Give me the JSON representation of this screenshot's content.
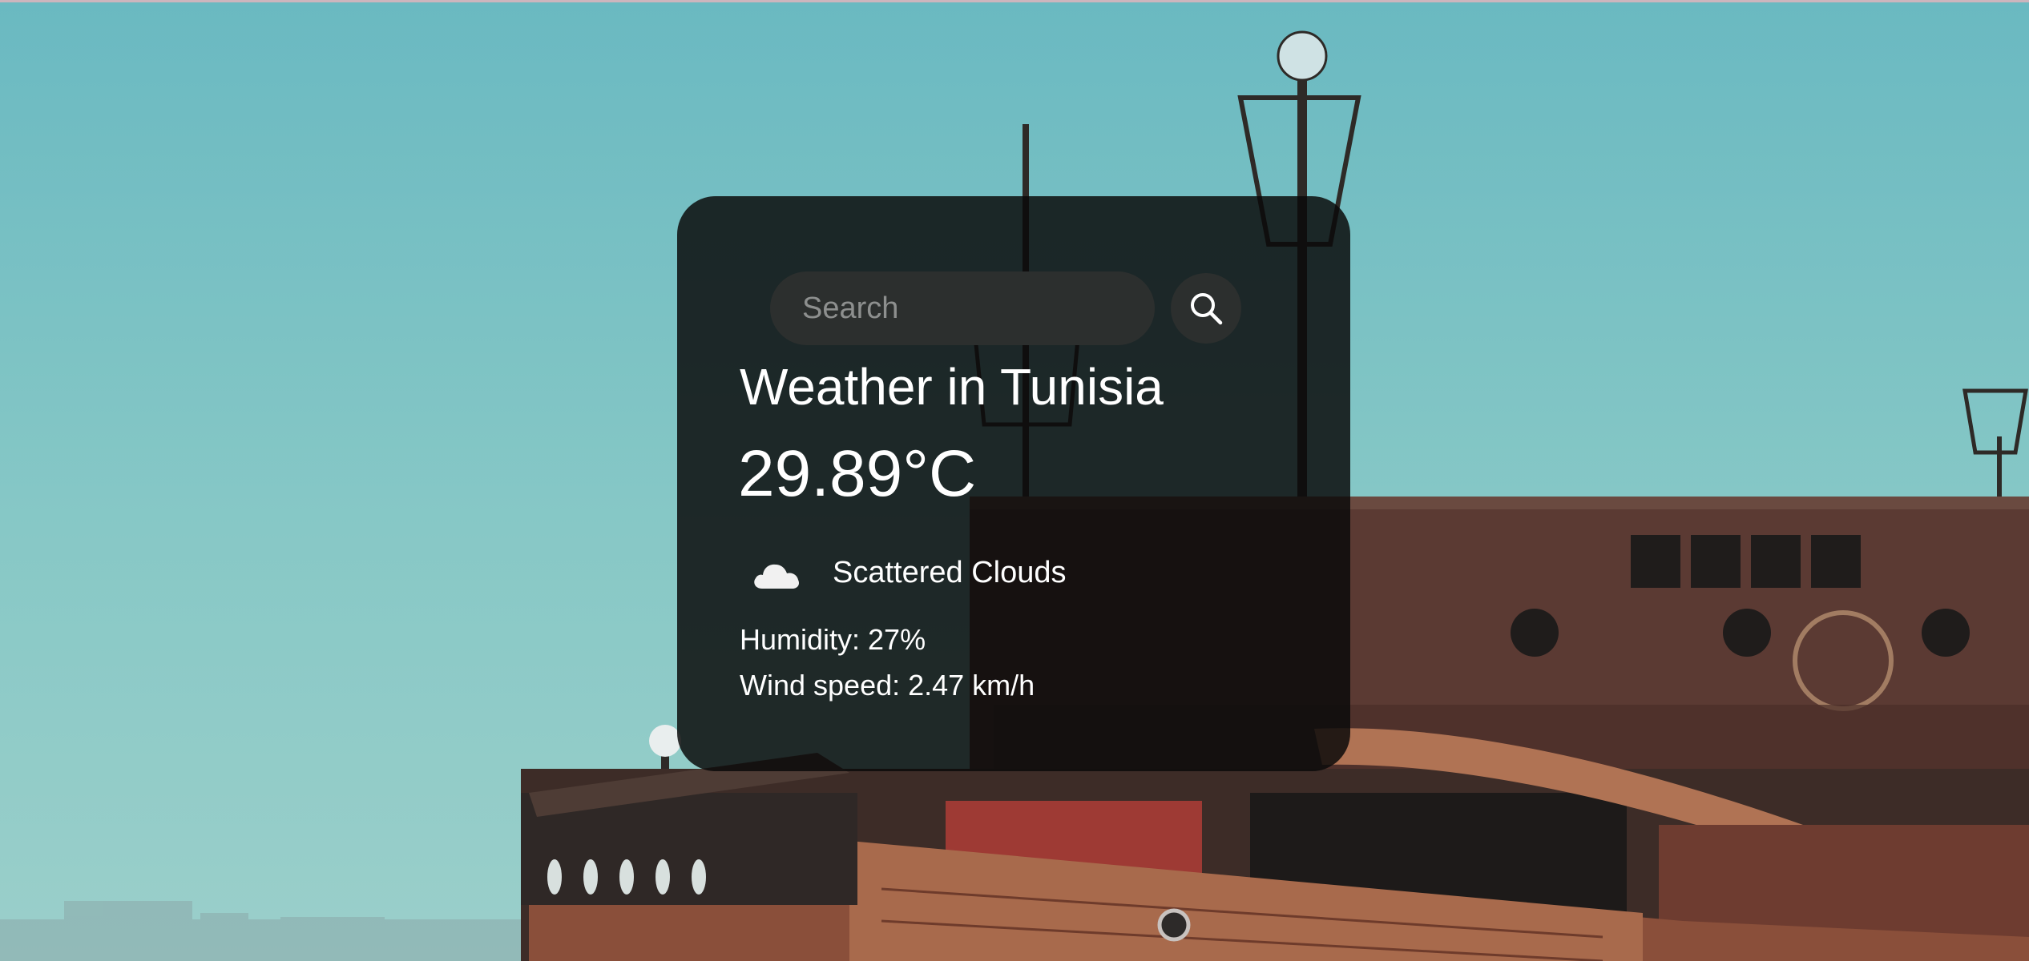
{
  "search": {
    "placeholder": "Search",
    "value": ""
  },
  "weather": {
    "title": "Weather in Tunisia",
    "temperature": "29.89°C",
    "description": "Scattered Clouds",
    "humidity": "Humidity: 27%",
    "wind": "Wind speed: 2.47 km/h"
  },
  "icons": {
    "search": "search-icon",
    "condition": "cloud-icon"
  },
  "colors": {
    "card_background": "#0a0a0a",
    "input_background": "#2c2f2e",
    "text": "#ffffff",
    "placeholder": "#8d8f8e",
    "sky": "#7cc4c4"
  }
}
